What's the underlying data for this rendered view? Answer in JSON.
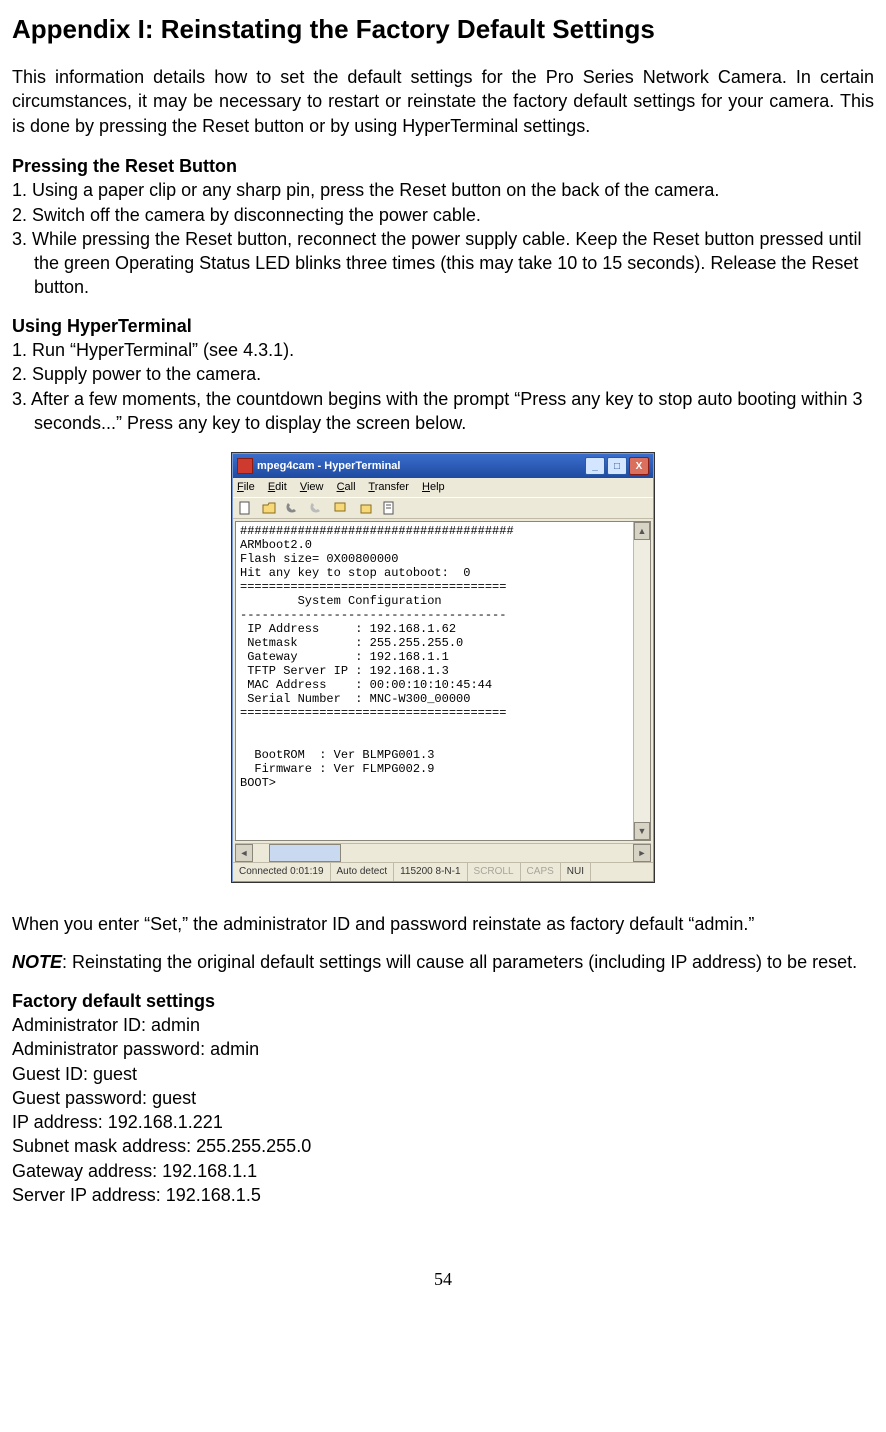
{
  "page": {
    "title": "Appendix I: Reinstating the Factory Default Settings",
    "intro": "This information details how to set the default settings for the Pro Series Network Camera. In certain circumstances, it may be necessary to restart or reinstate the factory default settings for your camera. This is done by pressing the Reset button or by using HyperTerminal settings.",
    "section_reset_head": "Pressing the Reset Button",
    "reset1": "1. Using a paper clip or any sharp pin, press the Reset button on the back of the camera.",
    "reset2": "2. Switch off the camera by disconnecting the power cable.",
    "reset3": "3. While pressing the Reset button, reconnect the power supply cable. Keep the Reset button pressed until the green Operating Status LED blinks three times (this may take 10 to 15 seconds). Release the Reset button.",
    "section_ht_head": "Using HyperTerminal",
    "ht1": "1. Run “HyperTerminal” (see 4.3.1).",
    "ht2": "2. Supply power to the camera.",
    "ht3": "3. After a few moments, the countdown begins with the prompt “Press any key to stop auto booting within 3 seconds...” Press any key to display the screen below.",
    "below_enter": "When you enter “Set,” the administrator ID and password reinstate as factory default “admin.”",
    "note_label": "NOTE",
    "note_text": ": Reinstating the original default settings will cause all parameters (including IP address) to be reset.",
    "factory_head": "Factory default settings",
    "factory": {
      "admin_id": "Administrator ID: admin",
      "admin_pw": "Administrator password: admin",
      "guest_id": "Guest ID: guest",
      "guest_pw": "Guest password: guest",
      "ip": "IP address: 192.168.1.221",
      "subnet": "Subnet mask address: 255.255.255.0",
      "gateway": "Gateway address: 192.168.1.1",
      "server": "Server IP address: 192.168.1.5"
    },
    "page_number": "54"
  },
  "hyperterminal": {
    "title": "mpeg4cam - HyperTerminal",
    "menu": {
      "file": "File",
      "edit": "Edit",
      "view": "View",
      "call": "Call",
      "transfer": "Transfer",
      "help": "Help"
    },
    "terminal_text": "######################################\nARMboot2.0\nFlash size= 0X00800000\nHit any key to stop autoboot:  0\n=====================================\n        System Configuration\n-------------------------------------\n IP Address     : 192.168.1.62\n Netmask        : 255.255.255.0\n Gateway        : 192.168.1.1\n TFTP Server IP : 192.168.1.3\n MAC Address    : 00:00:10:10:45:44\n Serial Number  : MNC-W300_00000\n=====================================\n\n\n  BootROM  : Ver BLMPG001.3\n  Firmware : Ver FLMPG002.9\nBOOT>",
    "status": {
      "connected": "Connected 0:01:19",
      "detect": "Auto detect",
      "line": "115200 8-N-1",
      "scroll": "SCROLL",
      "caps": "CAPS",
      "num": "NUI"
    },
    "winbtns": {
      "min": "_",
      "max": "□",
      "close": "X"
    }
  }
}
